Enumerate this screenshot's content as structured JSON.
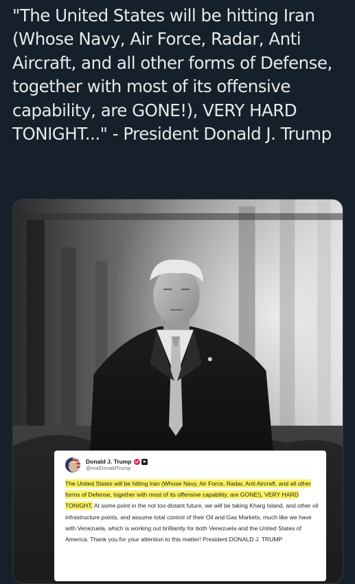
{
  "tweet": {
    "text": "\"The United States will be hitting Iran (Whose Navy, Air Force, Radar, Anti Aircraft, and all other forms of Defense, together with most of its offensive capability, are GONE!), VERY HARD TONIGHT...\" - President Donald J. Trump"
  },
  "media": {
    "photo_icon": "photo-of-man-in-suit"
  },
  "post": {
    "author_name": "Donald J. Trump",
    "handle": "@realDonaldTrump",
    "verified_icon": "verified-badge-icon",
    "platform_icon": "truth-social-icon",
    "highlighted_text": "The United States will be hitting Iran (Whose Navy, Air Force, Radar, Anti Aircraft, and all other forms of Defense, together with most of its offensive capability, are GONE!), VERY HARD TONIGHT.",
    "body_text": " At some point in the not too distant future, we will be taking Kharg Island, and other oil infrastructure points, and assume total control of their Oil and Gas Markets, much like we have with Venezuela, which is working out brilliantly for both Venezuela and the United States of America. Thank you for your attention to this matter! President DONALD J. TRUMP",
    "highlight_color": "#fbf35f"
  },
  "colors": {
    "background": "#15202b",
    "text": "#e7e9ea"
  }
}
